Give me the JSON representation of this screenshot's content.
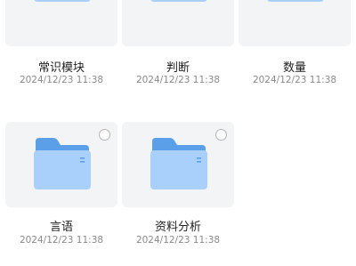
{
  "folders": [
    {
      "name": "常识模块",
      "date": "2024/12/23 11:38",
      "selectable": false
    },
    {
      "name": "判断",
      "date": "2024/12/23 11:38",
      "selectable": false
    },
    {
      "name": "数量",
      "date": "2024/12/23 11:38",
      "selectable": false
    },
    {
      "name": "言语",
      "date": "2024/12/23 11:38",
      "selectable": true
    },
    {
      "name": "资料分析",
      "date": "2024/12/23 11:38",
      "selectable": true
    }
  ],
  "colors": {
    "tile_bg": "#f3f4f6",
    "folder_back": "#5b9fe8",
    "folder_front": "#a8d0fb",
    "name_text": "#1f1f1f",
    "date_text": "#8a8a8a"
  },
  "icons": {
    "folder": "folder-icon",
    "select": "select-radio-icon"
  }
}
